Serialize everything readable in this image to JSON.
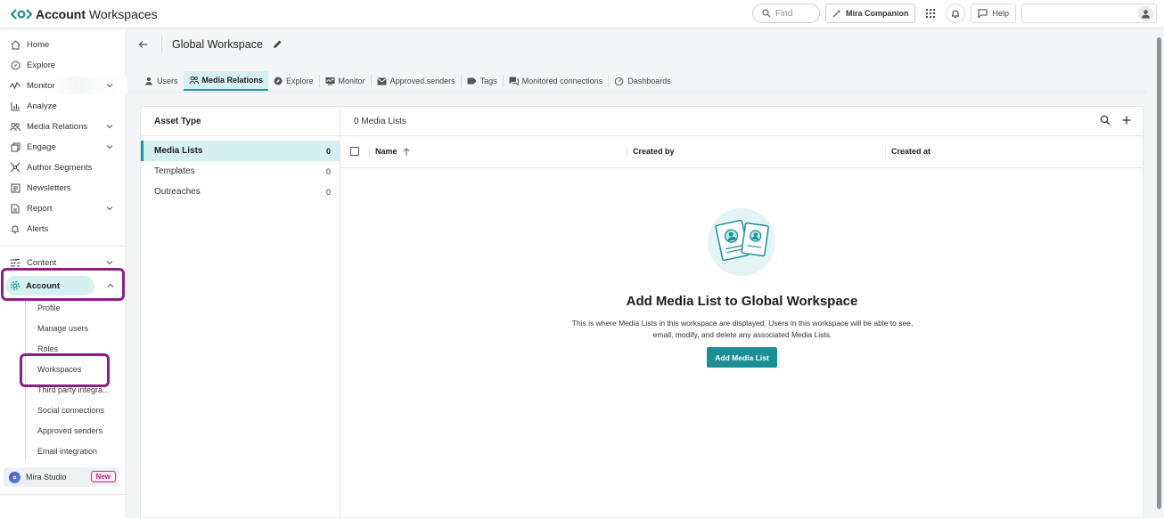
{
  "app": {
    "title_bold": "Account",
    "title_rest": " Workspaces"
  },
  "topbar": {
    "find_placeholder": "Find",
    "mira_companion_label": "Mira Companion",
    "help_label": "Help"
  },
  "sidebar": {
    "items": [
      {
        "label": "Home",
        "icon": "home-icon"
      },
      {
        "label": "Explore",
        "icon": "compass-icon"
      },
      {
        "label": "Monitor",
        "icon": "monitor-icon"
      },
      {
        "label": "Analyze",
        "icon": "chart-icon"
      },
      {
        "label": "Media Relations",
        "icon": "people-icon"
      },
      {
        "label": "Engage",
        "icon": "engage-icon"
      },
      {
        "label": "Author Segments",
        "icon": "segments-icon"
      },
      {
        "label": "Newsletters",
        "icon": "newsletter-icon"
      },
      {
        "label": "Report",
        "icon": "report-icon"
      },
      {
        "label": "Alerts",
        "icon": "bell-icon"
      },
      {
        "label": "Content",
        "icon": "content-icon"
      }
    ],
    "account": {
      "label": "Account",
      "icon": "gear-icon"
    },
    "account_sub": [
      "Profile",
      "Manage users",
      "Roles",
      "Workspaces",
      "Third party integra...",
      "Social connections",
      "Approved senders",
      "Email integration"
    ],
    "mira_studio": {
      "label": "Mira Studio",
      "badge": "New"
    }
  },
  "page": {
    "workspace_title": "Global Workspace",
    "tabs": [
      {
        "label": "Users",
        "icon": "user-icon"
      },
      {
        "label": "Media Relations",
        "icon": "people-icon"
      },
      {
        "label": "Explore",
        "icon": "compass-icon"
      },
      {
        "label": "Monitor",
        "icon": "monitor-icon"
      },
      {
        "label": "Approved senders",
        "icon": "mail-icon"
      },
      {
        "label": "Tags",
        "icon": "tag-icon"
      },
      {
        "label": "Monitored connections",
        "icon": "chat-icon"
      },
      {
        "label": "Dashboards",
        "icon": "gauge-icon"
      }
    ],
    "active_tab": "Media Relations"
  },
  "asset_panel": {
    "heading": "Asset Type",
    "rows": [
      {
        "label": "Media Lists",
        "count": "0"
      },
      {
        "label": "Templates",
        "count": "0"
      },
      {
        "label": "Outreaches",
        "count": "0"
      }
    ]
  },
  "main_panel": {
    "count_label": "0 Media Lists",
    "columns": {
      "name": "Name",
      "created_by": "Created by",
      "created_at": "Created at"
    },
    "empty_title": "Add Media List to Global Workspace",
    "empty_desc": "This is where Media Lists in this workspace are displayed. Users in this workspace will be able to see, email, modify, and delete any associated Media Lists.",
    "add_button": "Add Media List"
  },
  "colors": {
    "accent": "#1a9096",
    "accent_light": "#d6eff0",
    "annotation": "#8b1f83",
    "badge": "#c4287d"
  }
}
